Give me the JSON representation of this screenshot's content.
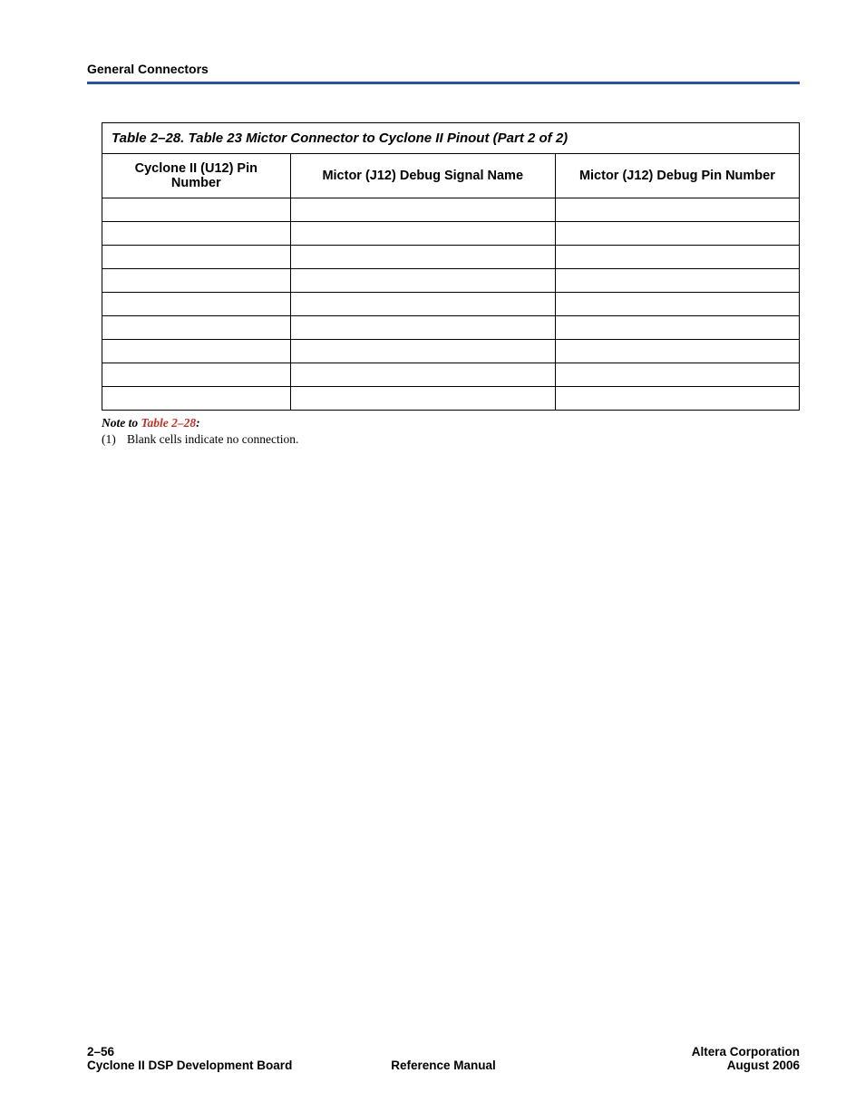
{
  "header": {
    "running_head": "General Connectors"
  },
  "table": {
    "caption": "Table 2–28. Table 23 Mictor Connector to Cyclone II Pinout  (Part 2 of 2)",
    "columns": [
      "Cyclone II (U12) Pin Number",
      "Mictor (J12) Debug Signal Name",
      "Mictor (J12) Debug Pin Number"
    ],
    "rows": [
      [
        "",
        "",
        ""
      ],
      [
        "",
        "",
        ""
      ],
      [
        "",
        "",
        ""
      ],
      [
        "",
        "",
        ""
      ],
      [
        "",
        "",
        ""
      ],
      [
        "",
        "",
        ""
      ],
      [
        "",
        "",
        ""
      ],
      [
        "",
        "",
        ""
      ],
      [
        "",
        "",
        ""
      ]
    ]
  },
  "note": {
    "title_prefix": "Note to ",
    "title_link": "Table 2–28",
    "title_suffix": ":",
    "items": [
      {
        "num": "(1)",
        "text": "Blank cells indicate no connection."
      }
    ]
  },
  "footer": {
    "page_number": "2–56",
    "doc_title": "Cyclone II DSP Development Board",
    "center": "Reference Manual",
    "company": "Altera Corporation",
    "date": "August 2006"
  }
}
